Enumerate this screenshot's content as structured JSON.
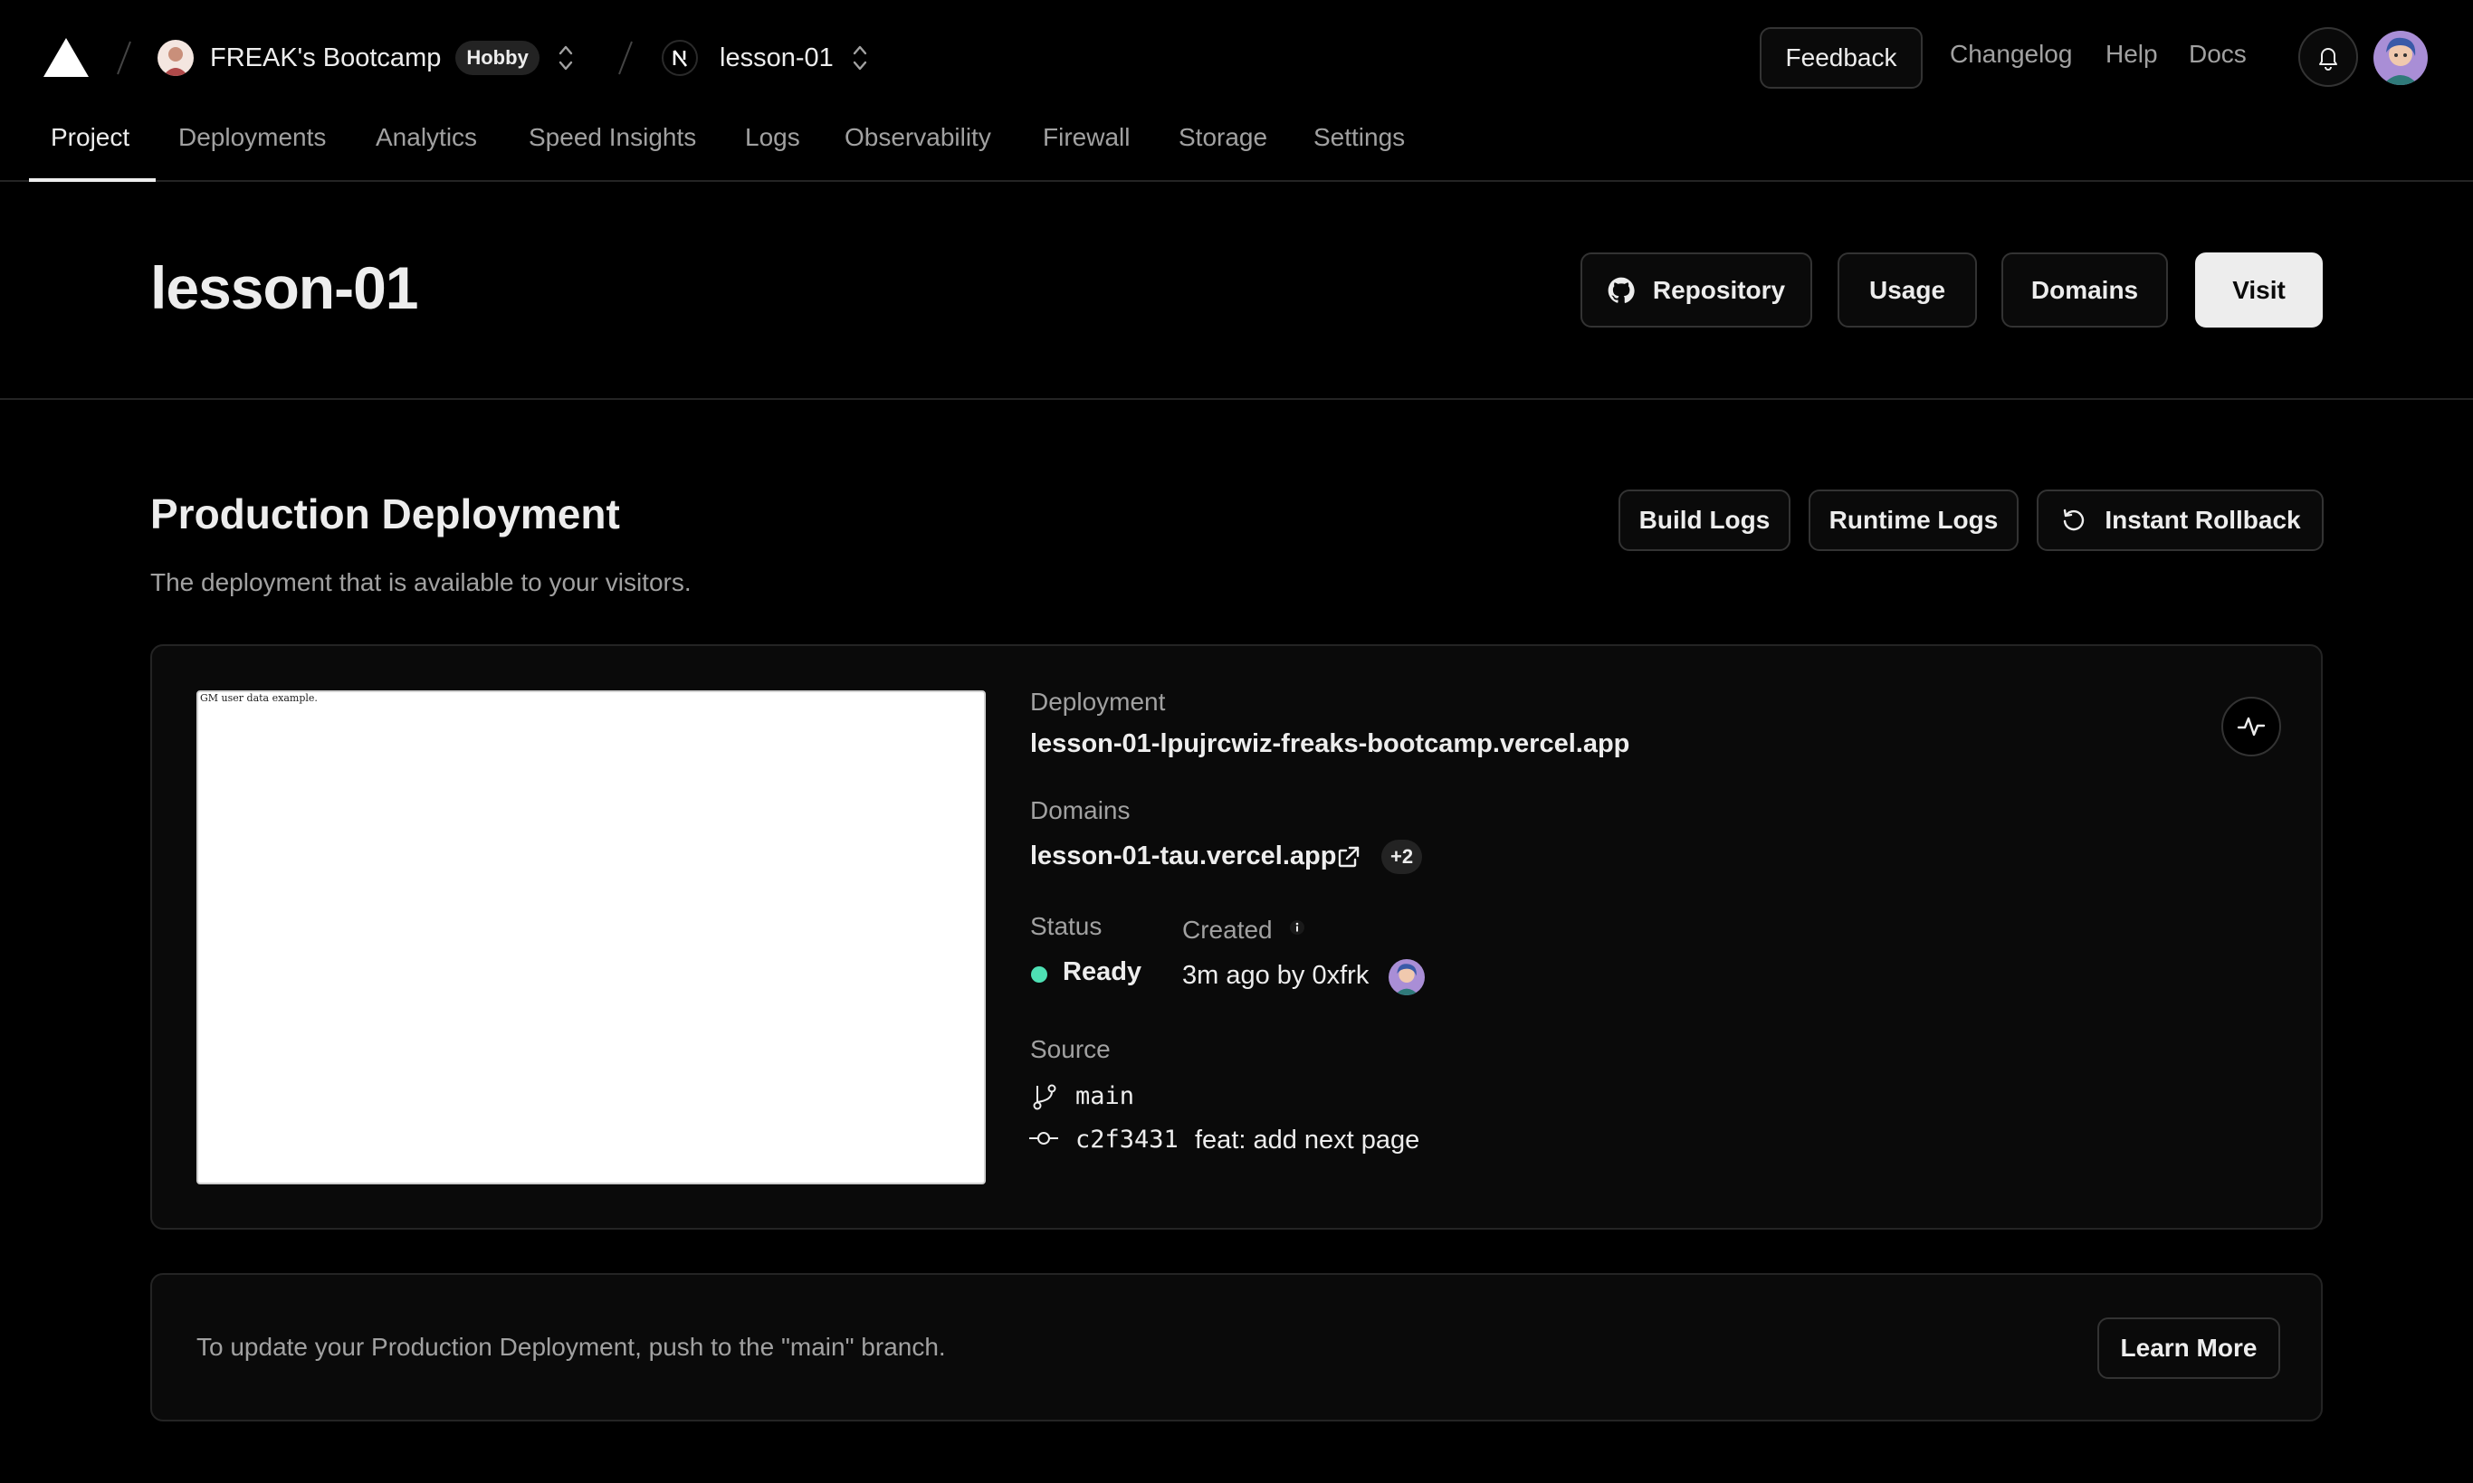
{
  "topbar": {
    "logo_icon": "vercel-triangle-icon",
    "team_name": "FREAK's Bootcamp",
    "plan_badge": "Hobby",
    "project_name": "lesson-01",
    "feedback_label": "Feedback",
    "changelog_label": "Changelog",
    "help_label": "Help",
    "docs_label": "Docs",
    "bell_icon": "bell-icon"
  },
  "tabs": [
    {
      "label": "Project",
      "active": true
    },
    {
      "label": "Deployments"
    },
    {
      "label": "Analytics"
    },
    {
      "label": "Speed Insights"
    },
    {
      "label": "Logs"
    },
    {
      "label": "Observability"
    },
    {
      "label": "Firewall"
    },
    {
      "label": "Storage"
    },
    {
      "label": "Settings"
    }
  ],
  "project": {
    "title": "lesson-01",
    "repository_label": "Repository",
    "usage_label": "Usage",
    "domains_label": "Domains",
    "visit_label": "Visit"
  },
  "production": {
    "title": "Production Deployment",
    "subtitle": "The deployment that is available to your visitors.",
    "build_logs_label": "Build Logs",
    "runtime_logs_label": "Runtime Logs",
    "rollback_label": "Instant Rollback",
    "preview_text": "GM user data example.",
    "deployment_label": "Deployment",
    "deployment_url": "lesson-01-lpujrcwiz-freaks-bootcamp.vercel.app",
    "domains_label": "Domains",
    "domain": "lesson-01-tau.vercel.app",
    "more_domains": "+2",
    "status_label": "Status",
    "status_value": "Ready",
    "status_color": "#4ee0b4",
    "created_label": "Created",
    "created_value": "3m ago by 0xfrk",
    "source_label": "Source",
    "branch": "main",
    "commit_hash": "c2f3431",
    "commit_message": "feat: add next page"
  },
  "notice": {
    "text": "To update your Production Deployment, push to the \"main\" branch.",
    "learn_more_label": "Learn More"
  }
}
